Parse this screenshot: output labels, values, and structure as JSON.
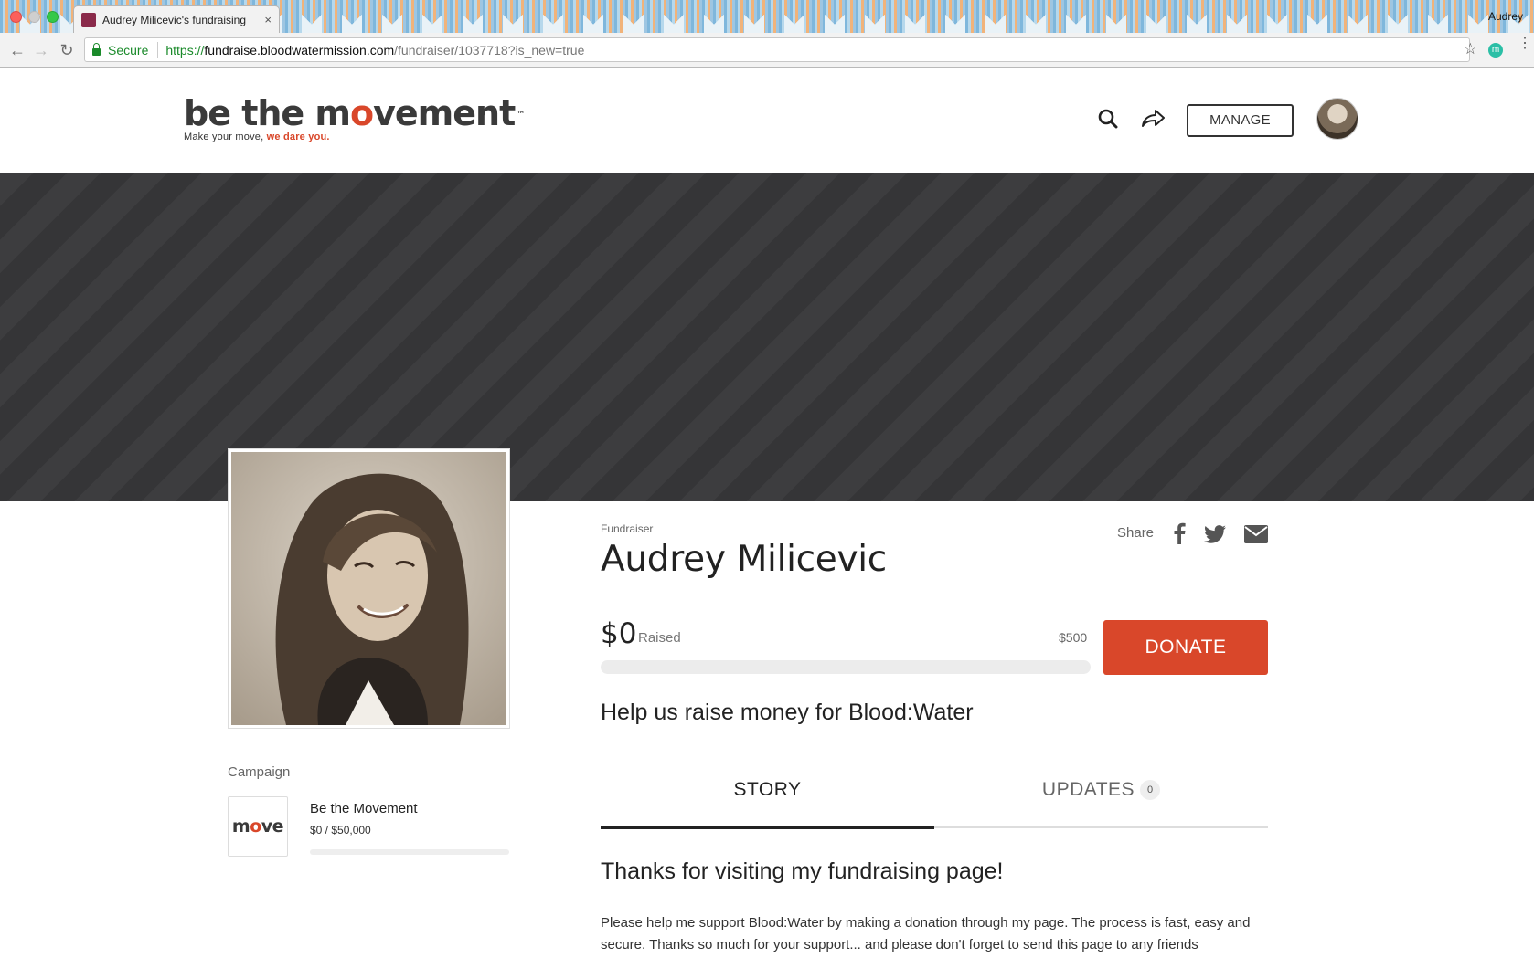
{
  "browser": {
    "tab_title": "Audrey Milicevic's fundraising",
    "tab_close": "×",
    "profile_name": "Audrey",
    "secure_label": "Secure",
    "url_scheme": "https://",
    "url_host": "fundraise.bloodwatermission.com",
    "url_path": "/fundraiser/1037718?is_new=true",
    "extension_letter": "m"
  },
  "header": {
    "logo_text_a": "be the m",
    "logo_text_b": "o",
    "logo_text_c": "vement",
    "logo_tm": "™",
    "logo_tag_a": "Make your move, ",
    "logo_tag_b": "we dare you.",
    "manage_label": "MANAGE"
  },
  "profile": {
    "role_label": "Fundraiser",
    "name": "Audrey Milicevic",
    "share_label": "Share",
    "raised": "$0",
    "raised_label": "Raised",
    "goal": "$500",
    "progress_fraction": 0,
    "donate_label": "DONATE",
    "tagline": "Help us raise money for Blood:Water"
  },
  "campaign": {
    "label": "Campaign",
    "logo_a": "m",
    "logo_b": "o",
    "logo_c": "ve",
    "name": "Be the Movement",
    "amount": "$0 / $50,000",
    "progress_fraction": 0
  },
  "tabs": {
    "story": "STORY",
    "updates": "UPDATES",
    "updates_count": "0"
  },
  "story": {
    "heading": "Thanks for visiting my fundraising page!",
    "body": "Please help me support Blood:Water by making a donation through my page. The process is fast, easy and secure. Thanks so much for your support... and please don't forget to send this page to any friends"
  },
  "colors": {
    "accent": "#d9472a",
    "banner": "#3a3a3c"
  },
  "icons": {
    "search": "search-icon",
    "share": "share-arrow-icon",
    "facebook": "facebook-icon",
    "twitter": "twitter-icon",
    "email": "envelope-icon"
  }
}
